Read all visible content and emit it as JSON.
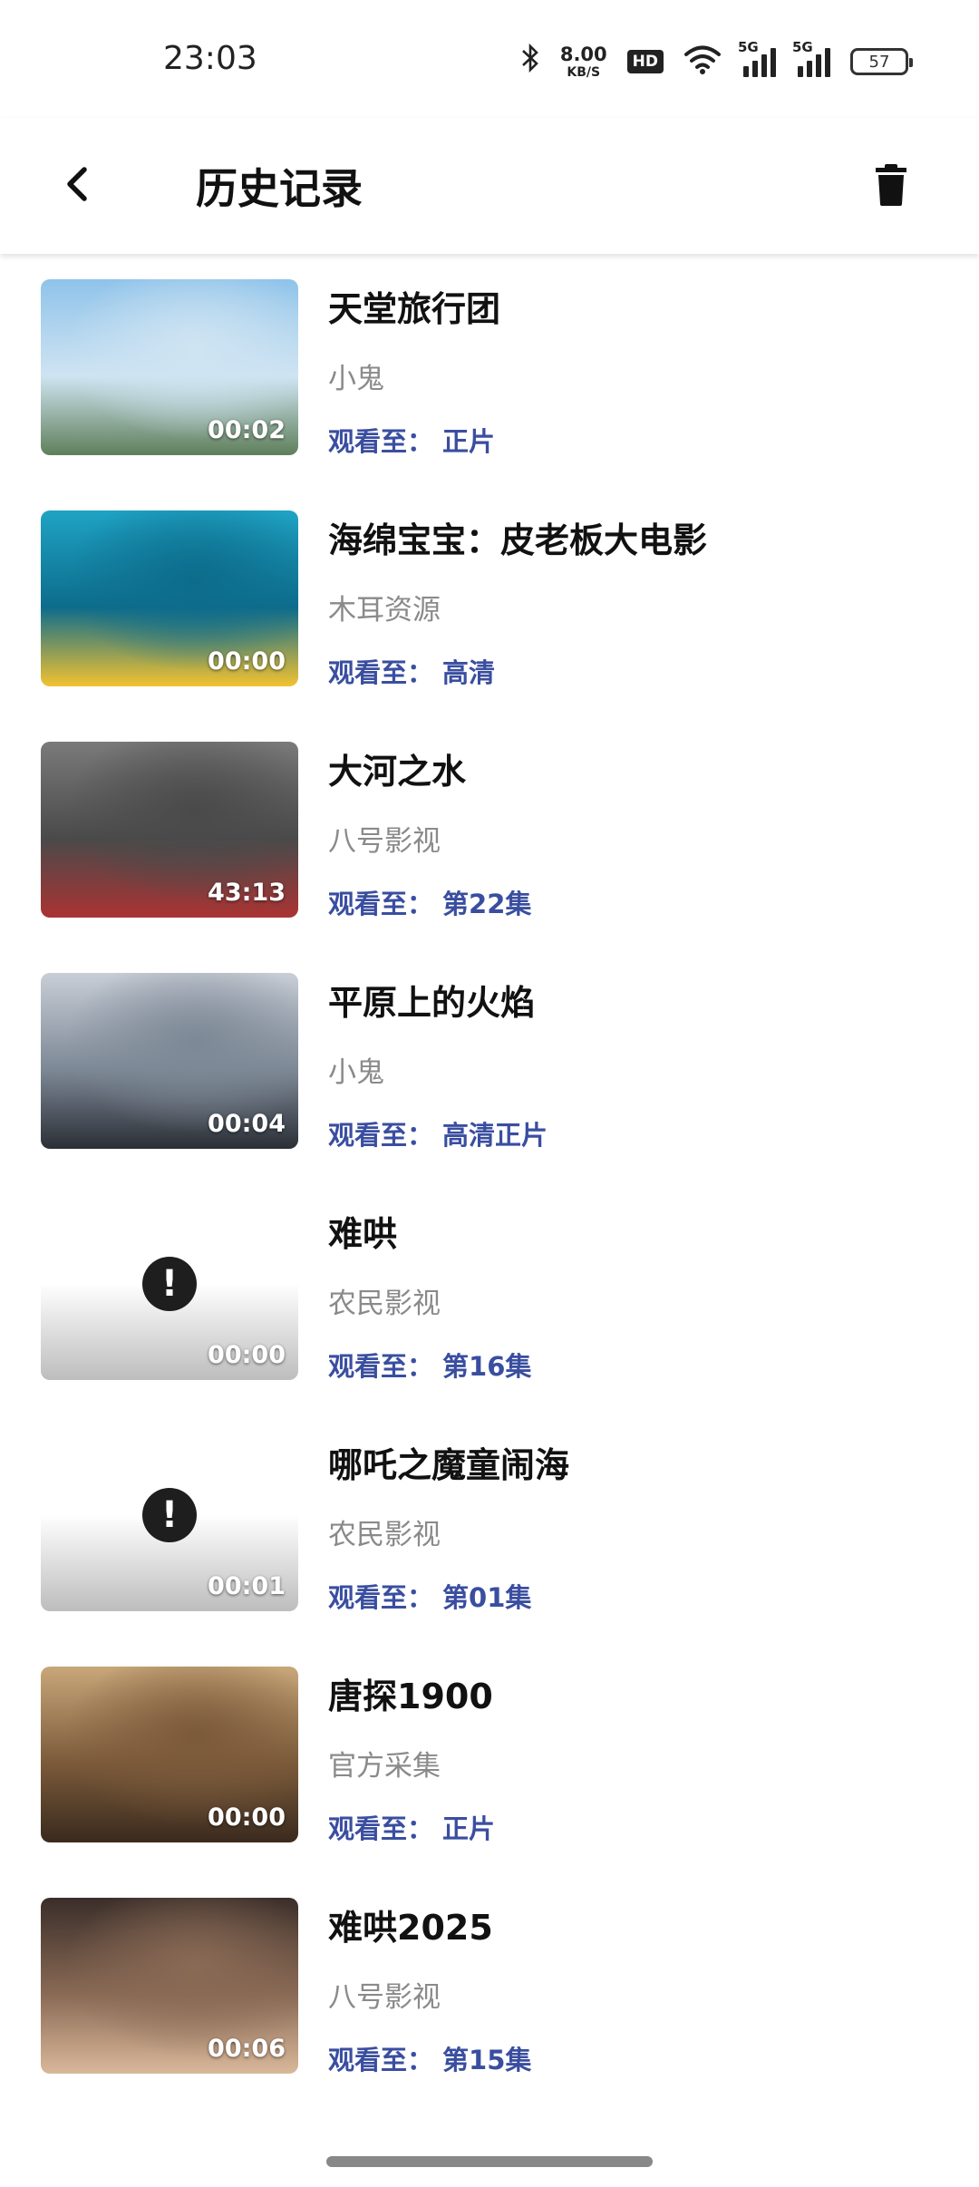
{
  "status_bar": {
    "time": "23:03",
    "net_speed_value": "8.00",
    "net_speed_unit": "KB/S",
    "hd_badge": "HD",
    "signal1_label": "5G",
    "signal2_label": "5G",
    "battery": "57",
    "icons": [
      "bluetooth-icon",
      "hd-icon",
      "wifi-icon",
      "signal-icon",
      "signal-icon",
      "battery-icon"
    ]
  },
  "header": {
    "title": "历史记录",
    "back_icon": "chevron-left-icon",
    "delete_icon": "trash-icon"
  },
  "history": [
    {
      "title": "天堂旅行团",
      "source": "小鬼",
      "progress_label": "观看至：",
      "progress_value": "正片",
      "duration": "00:02",
      "thumb": "image",
      "palette": [
        "#8fc3ea",
        "#cfe4f2",
        "#5f7f5a"
      ]
    },
    {
      "title": "海绵宝宝：皮老板大电影",
      "source": "木耳资源",
      "progress_label": "观看至：",
      "progress_value": "高清",
      "duration": "00:00",
      "thumb": "image",
      "palette": [
        "#1fa3c4",
        "#0d6c8c",
        "#f2c230"
      ]
    },
    {
      "title": "大河之水",
      "source": "八号影视",
      "progress_label": "观看至：",
      "progress_value": "第22集",
      "duration": "43:13",
      "thumb": "image",
      "palette": [
        "#7a7a7a",
        "#4a4a4a",
        "#a33"
      ]
    },
    {
      "title": "平原上的火焰",
      "source": "小鬼",
      "progress_label": "观看至：",
      "progress_value": "高清正片",
      "duration": "00:04",
      "thumb": "image",
      "palette": [
        "#c8ced6",
        "#7d8896",
        "#2b2f36"
      ]
    },
    {
      "title": "难哄",
      "source": "农民影视",
      "progress_label": "观看至：",
      "progress_value": "第16集",
      "duration": "00:00",
      "thumb": "error",
      "palette": [
        "#ffffff",
        "#ffffff",
        "#bdbdbd"
      ]
    },
    {
      "title": "哪吒之魔童闹海",
      "source": "农民影视",
      "progress_label": "观看至：",
      "progress_value": "第01集",
      "duration": "00:01",
      "thumb": "error",
      "palette": [
        "#ffffff",
        "#ffffff",
        "#bdbdbd"
      ]
    },
    {
      "title": "唐探1900",
      "source": "官方采集",
      "progress_label": "观看至：",
      "progress_value": "正片",
      "duration": "00:00",
      "thumb": "image",
      "palette": [
        "#c9a77a",
        "#7b5a3a",
        "#3a2a1e"
      ]
    },
    {
      "title": "难哄2025",
      "source": "八号影视",
      "progress_label": "观看至：",
      "progress_value": "第15集",
      "duration": "00:06",
      "thumb": "image",
      "palette": [
        "#3a2e2a",
        "#8a6a55",
        "#d9b89a"
      ]
    }
  ]
}
